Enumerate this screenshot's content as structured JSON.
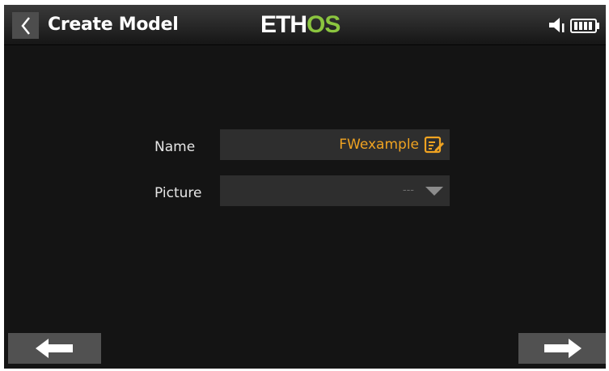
{
  "header": {
    "title": "Create Model",
    "logo_part1": "ETH",
    "logo_part2": "OS",
    "icons": [
      "back-chevron-icon",
      "speaker-icon",
      "battery-icon"
    ]
  },
  "form": {
    "name_label": "Name",
    "name_value": "FWexample",
    "picture_label": "Picture",
    "picture_value": "---"
  },
  "footer": {
    "icons": [
      "arrow-left-icon",
      "arrow-right-icon"
    ]
  },
  "colors": {
    "background": "#141414",
    "accent": "#f0a321",
    "logo_green": "#8bc53f",
    "field_bg": "#2e2e2e",
    "button_bg": "#515151"
  }
}
